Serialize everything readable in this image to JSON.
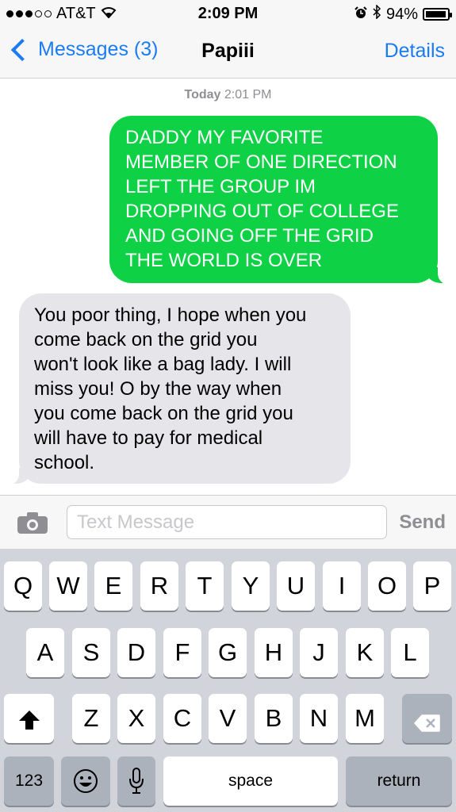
{
  "status_bar": {
    "carrier": "AT&T",
    "time": "2:09 PM",
    "battery": "94%",
    "signal_bars_filled": 3,
    "signal_bars_total": 5
  },
  "nav": {
    "back_label": "Messages (3)",
    "title": "Papiii",
    "details_label": "Details"
  },
  "timestamp": {
    "day": "Today",
    "time": "2:01 PM"
  },
  "messages": [
    {
      "direction": "outgoing",
      "text": "DADDY MY FAVORITE\nMEMBER OF ONE DIRECTION\nLEFT THE GROUP IM\nDROPPING OUT OF COLLEGE\nAND GOING OFF THE GRID\nTHE WORLD IS OVER"
    },
    {
      "direction": "incoming",
      "text": "You poor thing, I hope when you\ncome back on the grid you\nwon't look like a bag lady. I will\nmiss you! O by the way when\nyou come back on the grid you\nwill have to pay for medical\nschool."
    }
  ],
  "input_bar": {
    "placeholder": "Text Message",
    "send_label": "Send",
    "camera_icon": "camera-icon"
  },
  "keyboard": {
    "row1": [
      "Q",
      "W",
      "E",
      "R",
      "T",
      "Y",
      "U",
      "I",
      "O",
      "P"
    ],
    "row2": [
      "A",
      "S",
      "D",
      "F",
      "G",
      "H",
      "J",
      "K",
      "L"
    ],
    "row3": [
      "Z",
      "X",
      "C",
      "V",
      "B",
      "N",
      "M"
    ],
    "numbers_label": "123",
    "space_label": "space",
    "return_label": "return",
    "icons": {
      "shift": "shift-icon",
      "delete": "delete-icon",
      "emoji": "emoji-icon",
      "mic": "microphone-icon"
    }
  },
  "colors": {
    "accent": "#1a7cf5",
    "outgoing_bubble": "#0ed145",
    "incoming_bubble": "#e5e5ea"
  }
}
